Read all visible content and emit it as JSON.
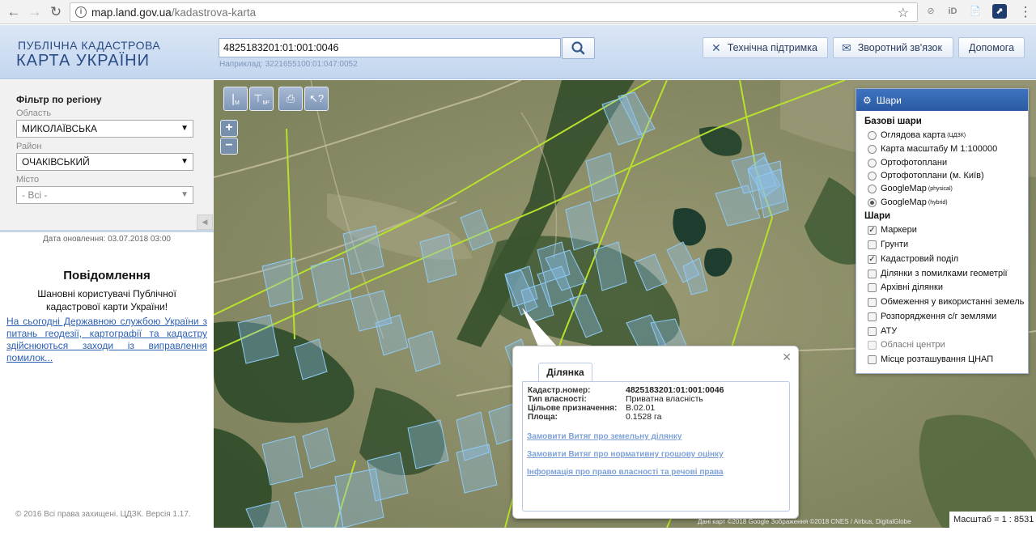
{
  "browser": {
    "url_host": "map.land.gov.ua",
    "url_path": "/kadastrova-karta",
    "extensions": [
      "⊘",
      "iD",
      "📄"
    ]
  },
  "header": {
    "logo_line1": "ПУБЛІЧНА КАДАСТРОВА",
    "logo_line2": "КАРТА УКРАЇНИ",
    "search_value": "4825183201:01:001:0046",
    "search_hint": "Наприклад: 3221655100:01:047:0052",
    "support_label": "Технічна підтримка",
    "feedback_label": "Зворотний зв'язок",
    "help_label": "Допомога"
  },
  "sidebar": {
    "filter_title": "Фільтр по регіону",
    "oblast_label": "Область",
    "oblast_value": "МИКОЛАЇВСЬКА",
    "rayon_label": "Район",
    "rayon_value": "ОЧАКІВСЬКИЙ",
    "city_label": "Місто",
    "city_value": "- Всі -",
    "update_text": "Дата оновлення: 03.07.2018 03:00",
    "notice_title": "Повідомлення",
    "notice_text": "Шановні користувачі Публічної кадастрової карти України!",
    "notice_link": "На сьогодні Державною службою України з питань геодезії, картографії та кадастру здійснюються заходи із виправлення помилок...",
    "copyright": "© 2016 Всі права захищені. ЦДЗК. Версія 1.17."
  },
  "map_tools": {
    "tool1": "M",
    "tool2": "M²"
  },
  "layers": {
    "title": "Шари",
    "base_title": "Базові шари",
    "base": [
      {
        "label": "Оглядова карта",
        "sup": "(ЦДЗК)",
        "checked": false
      },
      {
        "label": "Карта масштабу М 1:100000",
        "sup": "",
        "checked": false
      },
      {
        "label": "Ортофотоплани",
        "sup": "",
        "checked": false
      },
      {
        "label": "Ортофотоплани (м. Київ)",
        "sup": "",
        "checked": false
      },
      {
        "label": "GoogleMap",
        "sup": "(physical)",
        "checked": false
      },
      {
        "label": "GoogleMap",
        "sup": "(hybrid)",
        "checked": true
      }
    ],
    "overlay_title": "Шари",
    "overlays": [
      {
        "label": "Маркери",
        "checked": true,
        "disabled": false
      },
      {
        "label": "Грунти",
        "checked": false,
        "disabled": false
      },
      {
        "label": "Кадастровий поділ",
        "checked": true,
        "disabled": false
      },
      {
        "label": "Ділянки з помилками геометрії",
        "checked": false,
        "disabled": false
      },
      {
        "label": "Архівні ділянки",
        "checked": false,
        "disabled": false
      },
      {
        "label": "Обмеження у використанні земель",
        "checked": false,
        "disabled": false
      },
      {
        "label": "Розпорядження с/г землями",
        "checked": false,
        "disabled": false
      },
      {
        "label": "АТУ",
        "checked": false,
        "disabled": false
      },
      {
        "label": "Обласні центри",
        "checked": false,
        "disabled": true
      },
      {
        "label": "Місце розташування ЦНАП",
        "checked": false,
        "disabled": false
      }
    ]
  },
  "popup": {
    "tab": "Ділянка",
    "cadastre_label": "Кадастр.номер:",
    "cadastre_value": "4825183201:01:001:0046",
    "ownership_label": "Тип власності:",
    "ownership_value": "Приватна власність",
    "purpose_label": "Цільове призначення:",
    "purpose_value": "В.02.01",
    "area_label": "Площа:",
    "area_value": "0.1528 га",
    "link1": "Замовити Витяг про земельну ділянку",
    "link2": "Замовити Витяг про нормативну грошову оцінку",
    "link3": "Інформація про право власності та речові права"
  },
  "map_footer": {
    "attribution": "Дані карт ©2018 Google Зображення ©2018 CNES / Airbus, DigitalGlobe",
    "scale": "Масштаб = 1 : 8531"
  }
}
